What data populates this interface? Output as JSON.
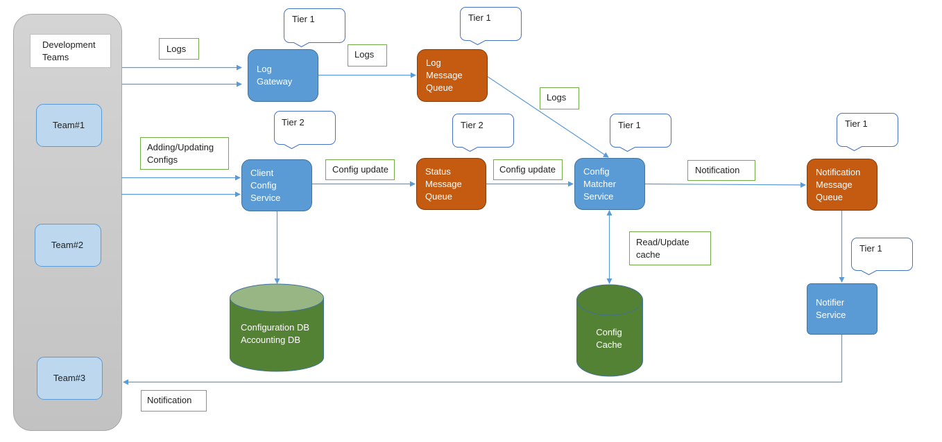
{
  "colors": {
    "service": "#5b9bd5",
    "queue": "#c55a11",
    "database": "#548235",
    "team": "#bdd7ee",
    "label_border": "#70ad47",
    "arrow": "#5b9bd5"
  },
  "teams": {
    "header_line1": "Development",
    "header_line2": "Teams",
    "items": [
      {
        "label": "Team#1"
      },
      {
        "label": "Team#2"
      },
      {
        "label": "Team#3"
      }
    ]
  },
  "nodes": {
    "log_gateway": {
      "line1": "Log",
      "line2": "Gateway",
      "tier": "Tier 1"
    },
    "log_mq": {
      "line1": "Log",
      "line2": "Message",
      "line3": "Queue",
      "tier": "Tier 1"
    },
    "client_config": {
      "line1": "Client",
      "line2": "Config",
      "line3": "Service",
      "tier": "Tier 2"
    },
    "status_mq": {
      "line1": "Status",
      "line2": "Message",
      "line3": "Queue",
      "tier": "Tier 2"
    },
    "config_matcher": {
      "line1": "Config",
      "line2": "Matcher",
      "line3": "Service",
      "tier": "Tier 1"
    },
    "notification_mq": {
      "line1": "Notification",
      "line2": "Message",
      "line3": "Queue",
      "tier": "Tier 1"
    },
    "notifier": {
      "line1": "Notifier",
      "line2": "Service",
      "tier": "Tier 1"
    },
    "config_db": {
      "line1": "Configuration DB",
      "line2": "Accounting DB"
    },
    "config_cache": {
      "line1": "Config",
      "line2": "Cache"
    }
  },
  "edge_labels": {
    "logs_in": "Logs",
    "logs_gateway_mq": "Logs",
    "logs_mq_matcher": "Logs",
    "configs_in_line1": "Adding/Updating",
    "configs_in_line2": "Configs",
    "config_update_1": "Config update",
    "config_update_2": "Config update",
    "notification_1": "Notification",
    "read_update_line1": "Read/Update",
    "read_update_line2": "cache",
    "notification_back": "Notification"
  }
}
